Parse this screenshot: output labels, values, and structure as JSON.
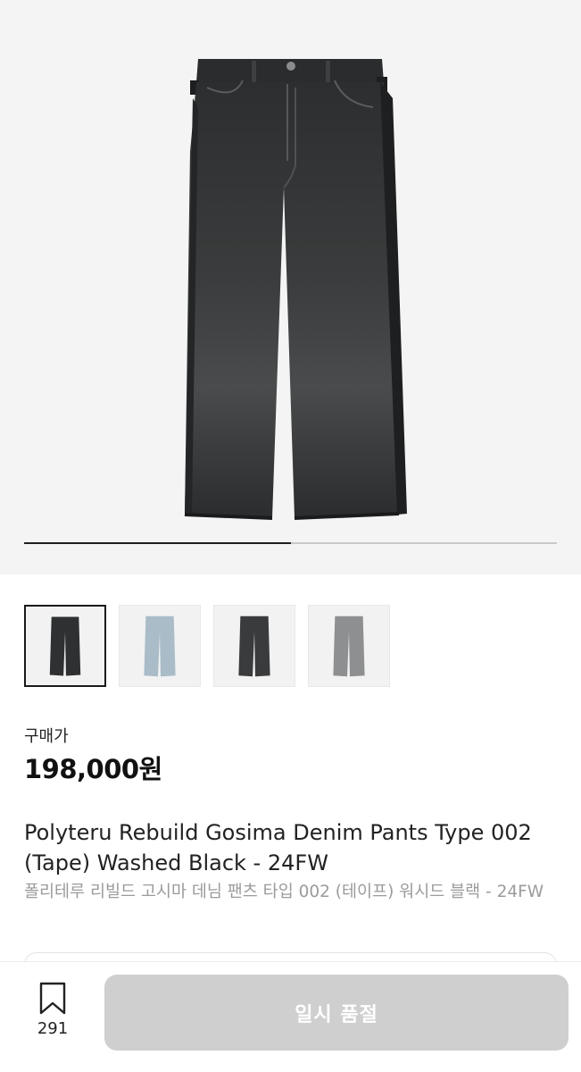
{
  "gallery": {
    "current_image_index": 0,
    "image_count": 4,
    "progress_fraction": 0.5,
    "main_image_alt": "Washed Black denim pants",
    "thumbnails": [
      {
        "name": "washed-black",
        "color": "#2e3031",
        "selected": true
      },
      {
        "name": "light-blue",
        "color": "#a9bcc8",
        "selected": false
      },
      {
        "name": "dark-charcoal",
        "color": "#3a3b3d",
        "selected": false
      },
      {
        "name": "grey",
        "color": "#8e8f91",
        "selected": false
      }
    ]
  },
  "product": {
    "price_label": "구매가",
    "price": "198,000원",
    "title_en": "Polyteru Rebuild Gosima Denim Pants Type 002 (Tape) Washed Black - 24FW",
    "title_ko": "폴리테루 리빌드 고시마 데님 팬츠 타입 002 (테이프) 워시드 블랙 - 24FW"
  },
  "bottom_bar": {
    "bookmark_icon": "bookmark-icon",
    "bookmark_count": "291",
    "cta_label": "일시 품절",
    "cta_disabled": true
  },
  "colors": {
    "hero_bg": "#f4f4f4",
    "cta_bg": "#cfcfcf",
    "muted_text": "#9b9b9b"
  }
}
